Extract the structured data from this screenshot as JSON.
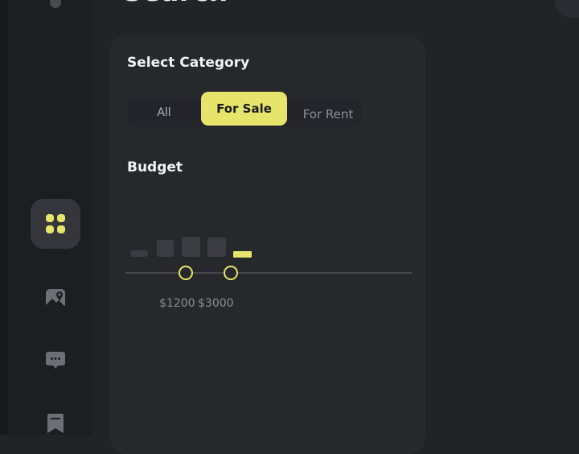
{
  "header": {
    "title": "Search"
  },
  "sidebar": {
    "items": [
      {
        "name": "dashboard",
        "icon": "grid-icon",
        "active": true
      },
      {
        "name": "map",
        "icon": "map-pin-icon"
      },
      {
        "name": "messages",
        "icon": "chat-bubble-icon"
      },
      {
        "name": "saved",
        "icon": "bookmark-icon"
      }
    ]
  },
  "filters": {
    "category": {
      "title": "Select Category",
      "options": [
        "All",
        "For Sale",
        "For Rent"
      ],
      "selected": "For Sale"
    },
    "budget": {
      "title": "Budget",
      "min_label": "$1200",
      "max_label": "$3000"
    }
  },
  "colors": {
    "accent": "#e6e46a",
    "background": "#222327",
    "panel": "#27282c",
    "sidebar": "#1d1e21"
  }
}
